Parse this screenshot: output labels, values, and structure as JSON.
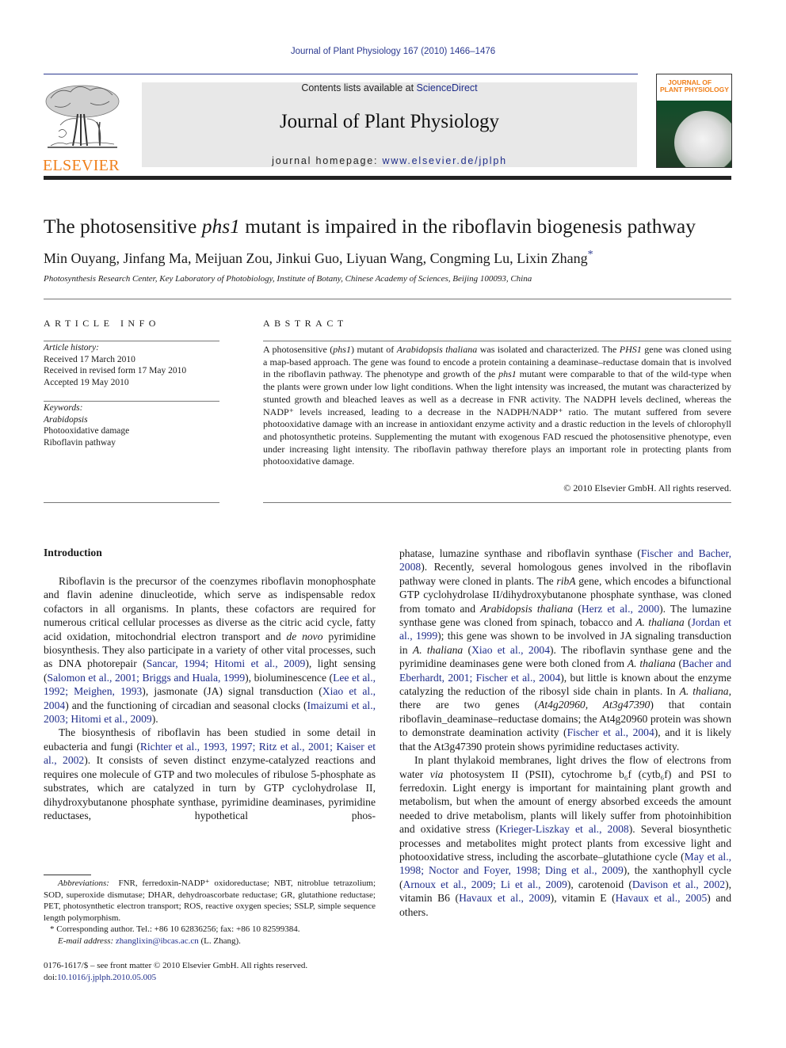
{
  "running_head": "Journal of Plant Physiology 167 (2010) 1466–1476",
  "publisher": {
    "logo_icon": "elsevier-tree-icon",
    "wordmark": "ELSEVIER"
  },
  "banner": {
    "contents_prefix": "Contents lists available at ",
    "contents_link": "ScienceDirect",
    "journal_title": "Journal of Plant Physiology",
    "homepage_prefix": "journal homepage: ",
    "homepage_link": "www.elsevier.de/jplph"
  },
  "cover": {
    "icon": "journal-cover-icon",
    "title_line1": "JOURNAL OF",
    "title_line2": "PLANT PHYSIOLOGY"
  },
  "article": {
    "title_pre": "The photosensitive ",
    "title_italic": "phs1",
    "title_post": " mutant is impaired in the riboflavin biogenesis pathway",
    "authors": "Min Ouyang, Jinfang Ma, Meijuan Zou, Jinkui Guo, Liyuan Wang, Congming Lu, Lixin Zhang",
    "author_mark": "*",
    "affiliation": "Photosynthesis Research Center, Key Laboratory of Photobiology, Institute of Botany, Chinese Academy of Sciences, Beijing 100093, China"
  },
  "article_info": {
    "heading": "ARTICLE INFO",
    "history_label": "Article history:",
    "history": [
      "Received 17 March 2010",
      "Received in revised form 17 May 2010",
      "Accepted 19 May 2010"
    ],
    "keywords_label": "Keywords:",
    "keywords": [
      "Arabidopsis",
      "Photooxidative damage",
      "Riboflavin pathway"
    ]
  },
  "abstract": {
    "heading": "ABSTRACT",
    "s1a": "A photosensitive (",
    "s1b": "phs1",
    "s1c": ") mutant of ",
    "s1d": "Arabidopsis thaliana",
    "s1e": " was isolated and characterized. The ",
    "s1f": "PHS1",
    "s1g": " gene was cloned using a map-based approach. The gene was found to encode a protein containing a deaminase–reductase domain that is involved in the riboflavin pathway. The phenotype and growth of the ",
    "s1h": "phs1",
    "s1i": " mutant were comparable to that of the wild-type when the plants were grown under low light conditions. When the light intensity was increased, the mutant was characterized by stunted growth and bleached leaves as well as a decrease in FNR activity. The NADPH levels declined, whereas the NADP⁺ levels increased, leading to a decrease in the NADPH/NADP⁺ ratio. The mutant suffered from severe photooxidative damage with an increase in antioxidant enzyme activity and a drastic reduction in the levels of chlorophyll and photosynthetic proteins. Supplementing the mutant with exogenous FAD rescued the photosensitive phenotype, even under increasing light intensity. The riboflavin pathway therefore plays an important role in protecting plants from photooxidative damage.",
    "copyright": "© 2010 Elsevier GmbH. All rights reserved."
  },
  "introduction": {
    "heading": "Introduction",
    "p1": [
      {
        "t": "Riboflavin is the precursor of the coenzymes riboflavin monophosphate and flavin adenine dinucleotide, which serve as indispensable redox cofactors in all organisms. In plants, these cofactors are required for numerous critical cellular processes as diverse as the citric acid cycle, fatty acid oxidation, mitochondrial electron transport and "
      },
      {
        "t": "de novo",
        "i": true
      },
      {
        "t": " pyrimidine biosynthesis. They also participate in a variety of other vital processes, such as DNA photorepair ("
      },
      {
        "t": "Sancar, 1994; Hitomi et al., 2009",
        "l": true
      },
      {
        "t": "), light sensing ("
      },
      {
        "t": "Salomon et al., 2001; Briggs and Huala, 1999",
        "l": true
      },
      {
        "t": "), bioluminescence ("
      },
      {
        "t": "Lee et al., 1992; Meighen, 1993",
        "l": true
      },
      {
        "t": "), jasmonate (JA) signal transduction ("
      },
      {
        "t": "Xiao et al., 2004",
        "l": true
      },
      {
        "t": ") and the functioning of circadian and seasonal clocks ("
      },
      {
        "t": "Imaizumi et al., 2003; Hitomi et al., 2009",
        "l": true
      },
      {
        "t": ")."
      }
    ],
    "p2": [
      {
        "t": "The biosynthesis of riboflavin has been studied in some detail in eubacteria and fungi ("
      },
      {
        "t": "Richter et al., 1993, 1997; Ritz et al., 2001; Kaiser et al., 2002",
        "l": true
      },
      {
        "t": "). It consists of seven distinct enzyme-catalyzed reactions and requires one molecule of GTP and two molecules of ribulose 5-phosphate as substrates, which are catalyzed in turn by GTP cyclohydrolase II, dihydroxybutanone phosphate synthase, pyrimidine deaminases, pyrimidine reductases, hypothetical phosphatase, lumazine synthase and riboflavin synthase ("
      },
      {
        "t": "Fischer and Bacher, 2008",
        "l": true
      },
      {
        "t": "). Recently, several homologous genes involved in the riboflavin pathway were cloned in plants. The "
      },
      {
        "t": "ribA",
        "i": true
      },
      {
        "t": " gene, which encodes a bifunctional GTP cyclohydrolase II/dihydroxybutanone phosphate synthase, was cloned from tomato and "
      },
      {
        "t": "Arabidopsis thaliana",
        "i": true
      },
      {
        "t": " ("
      },
      {
        "t": "Herz et al., 2000",
        "l": true
      },
      {
        "t": "). The lumazine synthase gene was cloned from spinach, tobacco and "
      },
      {
        "t": "A. thaliana",
        "i": true
      },
      {
        "t": " ("
      },
      {
        "t": "Jordan et al., 1999",
        "l": true
      },
      {
        "t": "); this gene was shown to be involved in JA signaling transduction in "
      },
      {
        "t": "A. thaliana",
        "i": true
      },
      {
        "t": " ("
      },
      {
        "t": "Xiao et al., 2004",
        "l": true
      },
      {
        "t": "). The riboflavin synthase gene and the pyrimidine deaminases gene were both cloned from "
      },
      {
        "t": "A. thaliana",
        "i": true
      },
      {
        "t": " ("
      },
      {
        "t": "Bacher and Eberhardt, 2001; Fischer et al., 2004",
        "l": true
      },
      {
        "t": "), but little is known about the enzyme catalyzing the reduction of the ribosyl side chain in plants. In "
      },
      {
        "t": "A. thaliana",
        "i": true
      },
      {
        "t": ", there are two genes ("
      },
      {
        "t": "At4g20960, At3g47390",
        "i": true
      },
      {
        "t": ") that contain riboflavin_deaminase–reductase domains; the At4g20960 protein was shown to demonstrate deamination activity ("
      },
      {
        "t": "Fischer et al., 2004",
        "l": true
      },
      {
        "t": "), and it is likely that the At3g47390 protein shows pyrimidine reductases activity."
      }
    ],
    "p3": [
      {
        "t": "In plant thylakoid membranes, light drives the flow of electrons from water "
      },
      {
        "t": "via",
        "i": true
      },
      {
        "t": " photosystem II (PSII), cytochrome b₆f (cytb₆f) and PSI to ferredoxin. Light energy is important for maintaining plant growth and metabolism, but when the amount of energy absorbed exceeds the amount needed to drive metabolism, plants will likely suffer from photoinhibition and oxidative stress ("
      },
      {
        "t": "Krieger-Liszkay et al., 2008",
        "l": true
      },
      {
        "t": "). Several biosynthetic processes and metabolites might protect plants from excessive light and photooxidative stress, including the ascorbate–glutathione cycle ("
      },
      {
        "t": "May et al., 1998; Noctor and Foyer, 1998; Ding et al., 2009",
        "l": true
      },
      {
        "t": "), the xanthophyll cycle ("
      },
      {
        "t": "Arnoux et al., 2009; Li et al., 2009",
        "l": true
      },
      {
        "t": "), carotenoid ("
      },
      {
        "t": "Davison et al., 2002",
        "l": true
      },
      {
        "t": "), vitamin B6 ("
      },
      {
        "t": "Havaux et al., 2009",
        "l": true
      },
      {
        "t": "), vitamin E ("
      },
      {
        "t": "Havaux et al., 2005",
        "l": true
      },
      {
        "t": ") and others."
      }
    ]
  },
  "footnotes": {
    "abbrev_label": "Abbreviations:",
    "abbrev_text": "FNR, ferredoxin-NADP⁺ oxidoreductase; NBT, nitroblue tetrazolium; SOD, superoxide dismutase; DHAR, dehydroascorbate reductase; GR, glutathione reductase; PET, photosynthetic electron transport; ROS, reactive oxygen species; SSLP, simple sequence length polymorphism.",
    "corresponding": "* Corresponding author. Tel.: +86 10 62836256; fax: +86 10 82599384.",
    "email_label": "E-mail address:",
    "email": "zhanglixin@ibcas.ac.cn",
    "email_suffix": " (L. Zhang)."
  },
  "front_matter": {
    "issn_line": "0176-1617/$ – see front matter © 2010 Elsevier GmbH. All rights reserved.",
    "doi_prefix": "doi:",
    "doi": "10.1016/j.jplph.2010.05.005"
  },
  "colors": {
    "link": "#1f2d8a",
    "elsevier_orange": "#f07f1a",
    "banner_bg": "#e8e8e8"
  }
}
